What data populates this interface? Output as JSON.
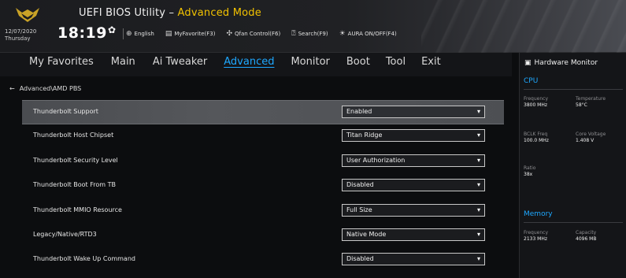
{
  "header": {
    "title_prefix": "UEFI BIOS Utility – ",
    "title_mode": "Advanced Mode",
    "date": "12/07/2020",
    "day": "Thursday",
    "time": "18:19",
    "toolbar": [
      {
        "icon": "globe-icon",
        "label": "English"
      },
      {
        "icon": "favorites-icon",
        "label": "MyFavorite(F3)"
      },
      {
        "icon": "fan-icon",
        "label": "Qfan Control(F6)"
      },
      {
        "icon": "search-icon",
        "label": "Search(F9)"
      },
      {
        "icon": "aura-icon",
        "label": "AURA ON/OFF(F4)"
      }
    ]
  },
  "nav": {
    "tabs": [
      "My Favorites",
      "Main",
      "Ai Tweaker",
      "Advanced",
      "Monitor",
      "Boot",
      "Tool",
      "Exit"
    ],
    "active": "Advanced"
  },
  "breadcrumb": "Advanced\\AMD PBS",
  "settings": [
    {
      "label": "Thunderbolt Support",
      "value": "Enabled",
      "highlight": true
    },
    {
      "label": "Thunderbolt Host Chipset",
      "value": "Titan Ridge"
    },
    {
      "label": "Thunderbolt Security Level",
      "value": "User Authorization"
    },
    {
      "label": "Thunderbolt Boot From TB",
      "value": "Disabled"
    },
    {
      "label": "Thunderbolt MMIO Resource",
      "value": "Full Size"
    },
    {
      "label": "Legacy/Native/RTD3",
      "value": "Native Mode"
    },
    {
      "label": "Thunderbolt Wake Up Command",
      "value": "Disabled"
    }
  ],
  "hardware_monitor": {
    "title": "Hardware Monitor",
    "cpu": {
      "section": "CPU",
      "rows": [
        [
          {
            "k": "Frequency",
            "v": "3800 MHz"
          },
          {
            "k": "Temperature",
            "v": "58°C"
          }
        ],
        [
          {
            "k": "BCLK Freq",
            "v": "100.0 MHz"
          },
          {
            "k": "Core Voltage",
            "v": "1.408 V"
          }
        ],
        [
          {
            "k": "Ratio",
            "v": "38x"
          }
        ]
      ]
    },
    "memory": {
      "section": "Memory",
      "rows": [
        [
          {
            "k": "Frequency",
            "v": "2133 MHz"
          },
          {
            "k": "Capacity",
            "v": "4096 MB"
          }
        ]
      ]
    }
  },
  "colors": {
    "accent_blue": "#1ea8ff",
    "accent_yellow": "#f2c200"
  }
}
